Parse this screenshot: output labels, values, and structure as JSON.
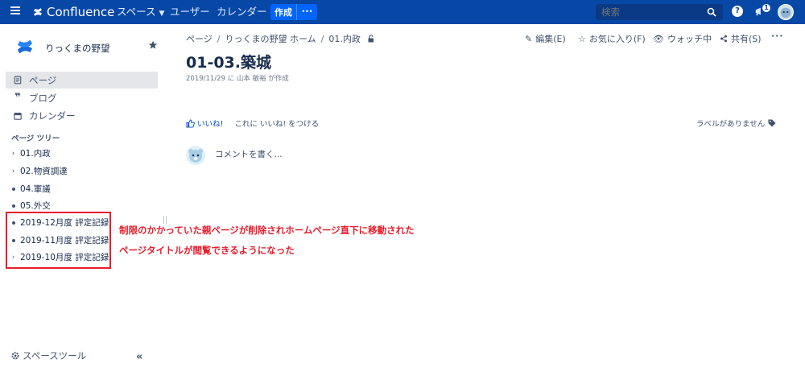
{
  "topbar": {
    "logo_text": "Confluence",
    "spaces_label": "スペース",
    "users_label": "ユーザー",
    "calendar_label": "カレンダー",
    "create_label": "作成",
    "create_more_label": "···",
    "search_placeholder": "検索",
    "help_label": "?",
    "notification_count": "1"
  },
  "sidebar": {
    "space_name": "りっくまの野望",
    "nav": [
      {
        "label": "ページ",
        "icon": "page-icon"
      },
      {
        "label": "ブログ",
        "icon": "quote-icon"
      },
      {
        "label": "カレンダー",
        "icon": "calendar-icon"
      }
    ],
    "tree_title": "ページ ツリー",
    "tree": [
      {
        "label": "01.内政",
        "marker": "expand"
      },
      {
        "label": "02.物資調達",
        "marker": "expand"
      },
      {
        "label": "04.軍議",
        "marker": "bullet"
      },
      {
        "label": "05.外交",
        "marker": "bullet"
      },
      {
        "label": "2019-12月度 評定記録",
        "marker": "bullet"
      },
      {
        "label": "2019-11月度 評定記録",
        "marker": "bullet"
      },
      {
        "label": "2019-10月度 評定記録",
        "marker": "expand"
      }
    ],
    "space_tools_label": "スペースツール",
    "collapse_label": "«"
  },
  "annotation": {
    "line1": "制限のかかっていた親ページが削除されホームページ直下に移動された",
    "line2": "ページタイトルが閲覧できるようになった",
    "color": "#e81d2c"
  },
  "main": {
    "breadcrumb": [
      "ページ",
      "りっくまの野望 ホーム",
      "01.内政"
    ],
    "actions": {
      "edit": "編集(E)",
      "favorite": "お気に入り(F)",
      "watch": "ウォッチ中",
      "share": "共有(S)",
      "more": "···"
    },
    "title": "01-03.築城",
    "byline": "2019/11/29 に 山本 敏裕 が作成",
    "like_label": "いいね!",
    "like_prompt": "これに いいね! をつける",
    "labels_text": "ラベルがありません",
    "comment_placeholder": "コメントを書く..."
  },
  "colors": {
    "topbar": "#0747a6",
    "create_button": "#0065ff",
    "link": "#0052cc",
    "text": "#172b4d"
  }
}
